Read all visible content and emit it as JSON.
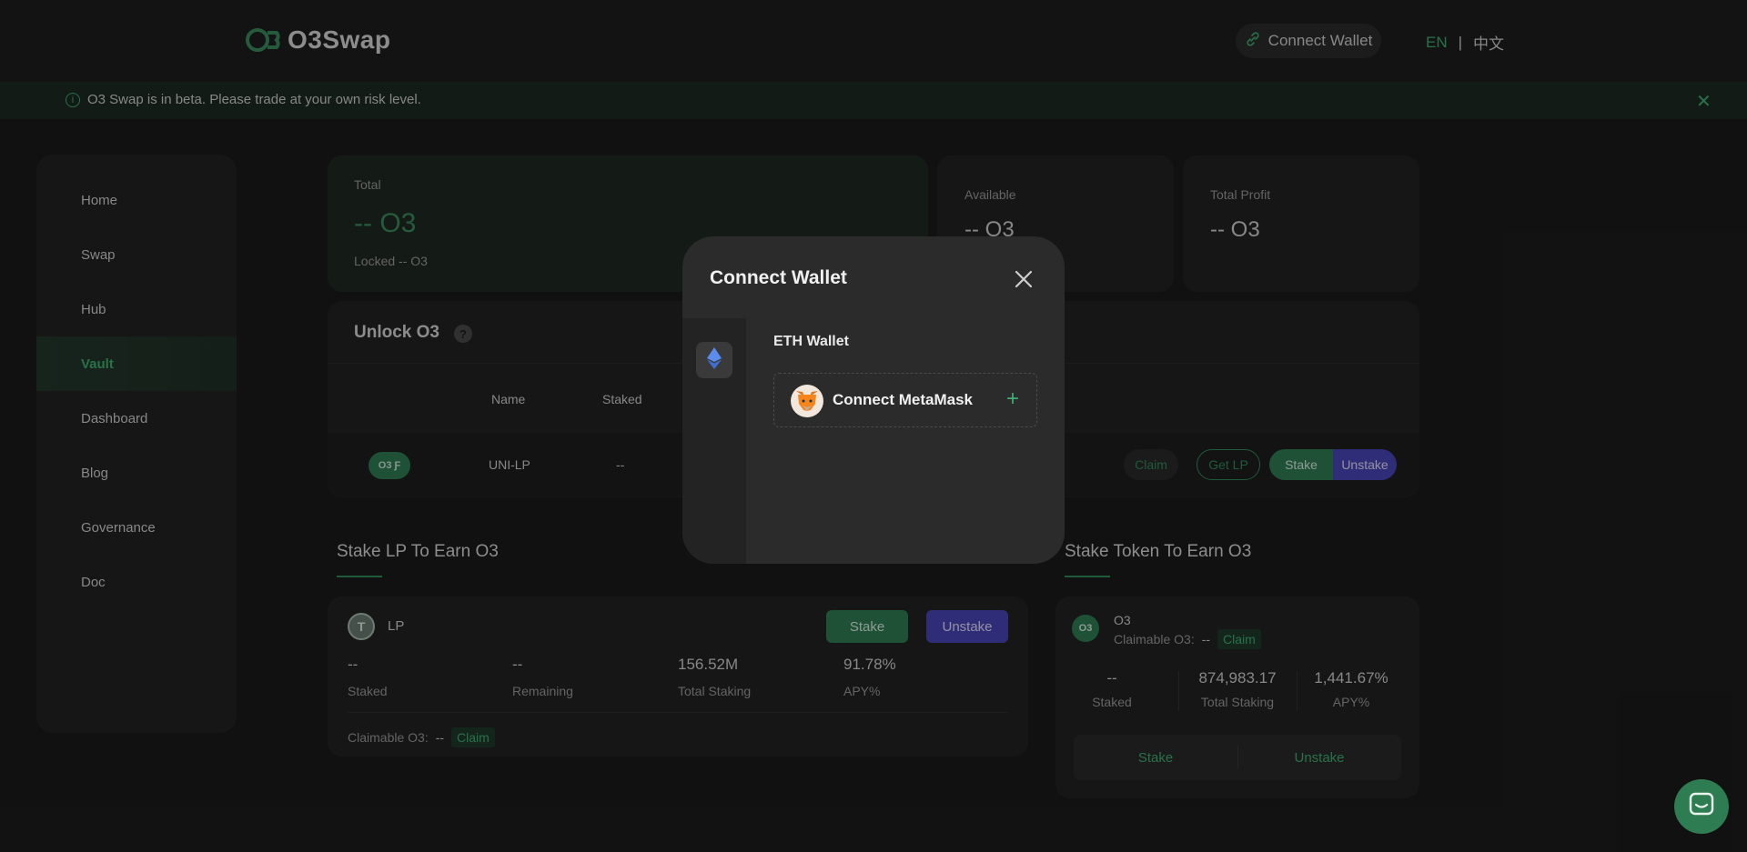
{
  "header": {
    "logo_text": "O3Swap",
    "connect_label": "Connect Wallet",
    "lang_en": "EN",
    "lang_sep": "|",
    "lang_zh": "中文"
  },
  "banner": {
    "text": "O3 Swap is in beta. Please trade at your own risk level.",
    "close": "✕"
  },
  "sidebar": {
    "items": [
      {
        "label": "Home"
      },
      {
        "label": "Swap"
      },
      {
        "label": "Hub"
      },
      {
        "label": "Vault"
      },
      {
        "label": "Dashboard"
      },
      {
        "label": "Blog"
      },
      {
        "label": "Governance"
      },
      {
        "label": "Doc"
      }
    ]
  },
  "totals": {
    "total_label": "Total",
    "total_value": "-- O3",
    "locked_text": "Locked -- O3",
    "available_label": "Available",
    "available_value": "-- O3",
    "profit_label": "Total Profit",
    "profit_value": "-- O3"
  },
  "unlock": {
    "title": "Unlock O3",
    "help": "?",
    "col_name": "Name",
    "col_staked": "Staked",
    "row_name": "UNI-LP",
    "row_staked": "--",
    "claim": "Claim",
    "get_lp": "Get LP",
    "stake": "Stake",
    "unstake": "Unstake"
  },
  "lp_section": {
    "title": "Stake LP To Earn O3",
    "name": "LP",
    "stake": "Stake",
    "unstake": "Unstake",
    "staked_value": "--",
    "staked_label": "Staked",
    "remaining_value": "--",
    "remaining_label": "Remaining",
    "total_staking_value": "156.52M",
    "total_staking_label": "Total Staking",
    "apy_value": "91.78%",
    "apy_label": "APY%",
    "claimable_label": "Claimable O3:",
    "claimable_value": "--",
    "claim": "Claim"
  },
  "token_section": {
    "title": "Stake Token To Earn O3",
    "name": "O3",
    "claimable_label": "Claimable O3:",
    "claimable_value": "--",
    "claim": "Claim",
    "staked_value": "--",
    "staked_label": "Staked",
    "total_staking_value": "874,983.17",
    "total_staking_label": "Total Staking",
    "apy_value": "1,441.67%",
    "apy_label": "APY%",
    "stake": "Stake",
    "unstake": "Unstake"
  },
  "modal": {
    "title": "Connect Wallet",
    "wallet_label": "ETH Wallet",
    "metamask_label": "Connect MetaMask"
  },
  "colors": {
    "accent_green": "#3fae72",
    "stake_green": "#2e7d52",
    "unstake_purple": "#4b45b8"
  }
}
